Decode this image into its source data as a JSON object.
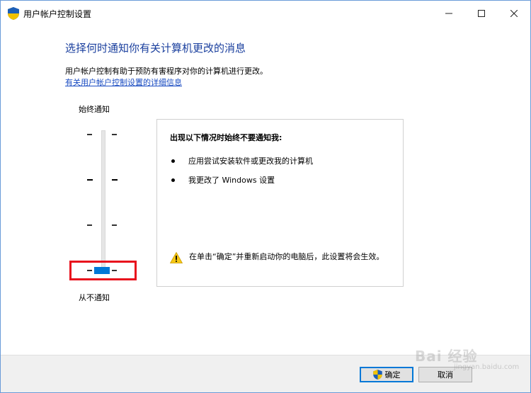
{
  "window": {
    "title": "用户帐户控制设置"
  },
  "main": {
    "heading": "选择何时通知你有关计算机更改的消息",
    "description": "用户帐户控制有助于预防有害程序对你的计算机进行更改。",
    "link": "有关用户帐户控制设置的详细信息"
  },
  "slider": {
    "top_label": "始终通知",
    "bottom_label": "从不通知",
    "levels": 4,
    "current_level": 1
  },
  "info_panel": {
    "title": "出现以下情况时始终不要通知我:",
    "bullets": [
      "应用尝试安装软件或更改我的计算机",
      "我更改了 Windows 设置"
    ],
    "warning": "在单击“确定”并重新启动你的电脑后，此设置将会生效。"
  },
  "footer": {
    "ok_label": "确定",
    "cancel_label": "取消"
  },
  "watermark": {
    "main": "Bai 经验",
    "sub": "jingyan.baidu.com"
  },
  "colors": {
    "accent": "#0078d7",
    "heading": "#1a3f9e",
    "link": "#1a4cc2",
    "highlight": "#e8101c"
  }
}
